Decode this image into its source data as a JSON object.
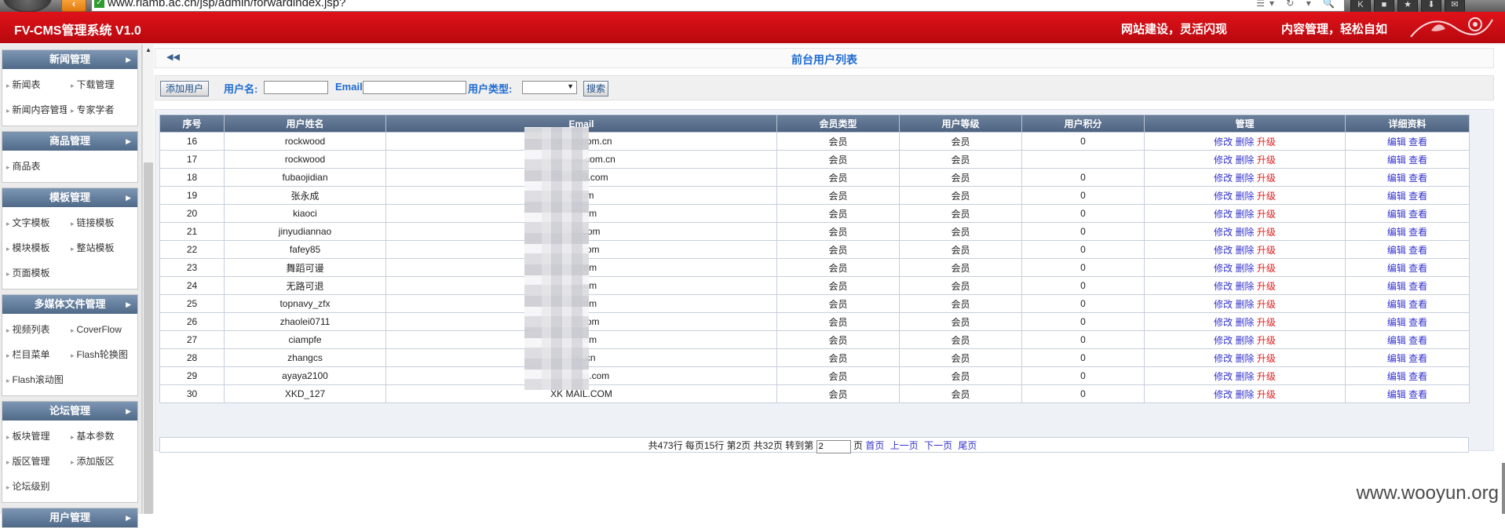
{
  "browser": {
    "url": "www.riamb.ac.cn/jsp/admin/forwardindex.jsp?",
    "back_icon": "‹",
    "toolbar_icons": [
      "K",
      "■",
      "★",
      "⬇",
      "✉"
    ]
  },
  "header": {
    "brand": "FV-CMS管理系统 V1.0",
    "slogan1": "网站建设，灵活闪现",
    "slogan2": "内容管理，轻松自如"
  },
  "sidebar": {
    "groups": [
      {
        "title": "新闻管理",
        "items": [
          "新闻表",
          "下载管理",
          "新闻内容管理",
          "专家学者"
        ]
      },
      {
        "title": "商品管理",
        "items": [
          "商品表"
        ]
      },
      {
        "title": "模板管理",
        "items": [
          "文字模板",
          "链接模板",
          "模块模板",
          "整站模板",
          "页面模板"
        ]
      },
      {
        "title": "多媒体文件管理",
        "items": [
          "视频列表",
          "CoverFlow",
          "栏目菜单",
          "Flash轮换图",
          "Flash滚动图"
        ]
      },
      {
        "title": "论坛管理",
        "items": [
          "板块管理",
          "基本参数",
          "版区管理",
          "添加版区",
          "论坛级别"
        ]
      },
      {
        "title": "用户管理",
        "items": []
      }
    ]
  },
  "main": {
    "back_arrows": "◀◀",
    "title": "前台用户列表",
    "search": {
      "add_button": "添加用户",
      "username_label": "用户名:",
      "username_value": "",
      "email_label": "Email:",
      "email_value": "",
      "type_label": "用户类型:",
      "type_value": "",
      "search_button": "搜索"
    },
    "table": {
      "headers": [
        "序号",
        "用户姓名",
        "Email",
        "会员类型",
        "用户等级",
        "用户积分",
        "管理",
        "详细资料"
      ],
      "action_labels": {
        "edit": "修改",
        "delete": "删除",
        "upgrade": "升级",
        "edit2": "编辑",
        "view": "查看"
      },
      "rows": [
        {
          "id": "16",
          "name": "rockwood",
          "email": "r wood.com.cn",
          "type": "会员",
          "level": "会员",
          "points": "0"
        },
        {
          "id": "17",
          "name": "rockwood",
          "email": "ric wood.com.cn",
          "type": "会员",
          "level": "会员",
          "points": ""
        },
        {
          "id": "18",
          "name": "fubaojidian",
          "email": "5 @139.com",
          "type": "会员",
          "level": "会员",
          "points": "0"
        },
        {
          "id": "19",
          "name": "张永成",
          "email": "s.com",
          "type": "会员",
          "level": "会员",
          "points": "0"
        },
        {
          "id": "20",
          "name": "kiaoci",
          "email": "63.com",
          "type": "会员",
          "level": "会员",
          "points": "0"
        },
        {
          "id": "21",
          "name": "jinyudiannao",
          "email": "mail.com",
          "type": "会员",
          "level": "会员",
          "points": "0"
        },
        {
          "id": "22",
          "name": "fafey85",
          "email": "163.com",
          "type": "会员",
          "level": "会员",
          "points": "0"
        },
        {
          "id": "23",
          "name": "舞蹈可谩",
          "email": "na.com",
          "type": "会员",
          "level": "会员",
          "points": "0"
        },
        {
          "id": "24",
          "name": "无路可退",
          "email": "na.com",
          "type": "会员",
          "level": "会员",
          "points": "0"
        },
        {
          "id": "25",
          "name": "topnavy_zfx",
          "email": "63.com",
          "type": "会员",
          "level": "会员",
          "points": "0"
        },
        {
          "id": "26",
          "name": "zhaolei0711",
          "email": "126.com",
          "type": "会员",
          "level": "会员",
          "points": "0"
        },
        {
          "id": "27",
          "name": "ciampfe",
          "email": "26.com",
          "type": "会员",
          "level": "会员",
          "points": "0"
        },
        {
          "id": "28",
          "name": "zhangcs",
          "email": "hoo.cn",
          "type": "会员",
          "level": "会员",
          "points": "0"
        },
        {
          "id": "29",
          "name": "ayaya2100",
          "email": "00@ .qq.com",
          "type": "会员",
          "level": "会员",
          "points": "0"
        },
        {
          "id": "30",
          "name": "XKD_127",
          "email": "XK MAIL.COM",
          "type": "会员",
          "level": "会员",
          "points": "0"
        }
      ]
    },
    "pager": {
      "summary": "共473行 每页15行  第2页 共32页  转到第",
      "page_input": "2",
      "page_suffix": "页",
      "links": [
        "首页",
        "上一页",
        "下一页",
        "尾页"
      ]
    }
  },
  "watermark": "www.wooyun.org",
  "colors": {
    "header_red": "#d10d14",
    "menu_head": "#5f7897",
    "table_head": "#5a6f8c",
    "link_blue": "#3333cc",
    "link_red": "#e02020",
    "title_blue": "#1d6ad1"
  }
}
